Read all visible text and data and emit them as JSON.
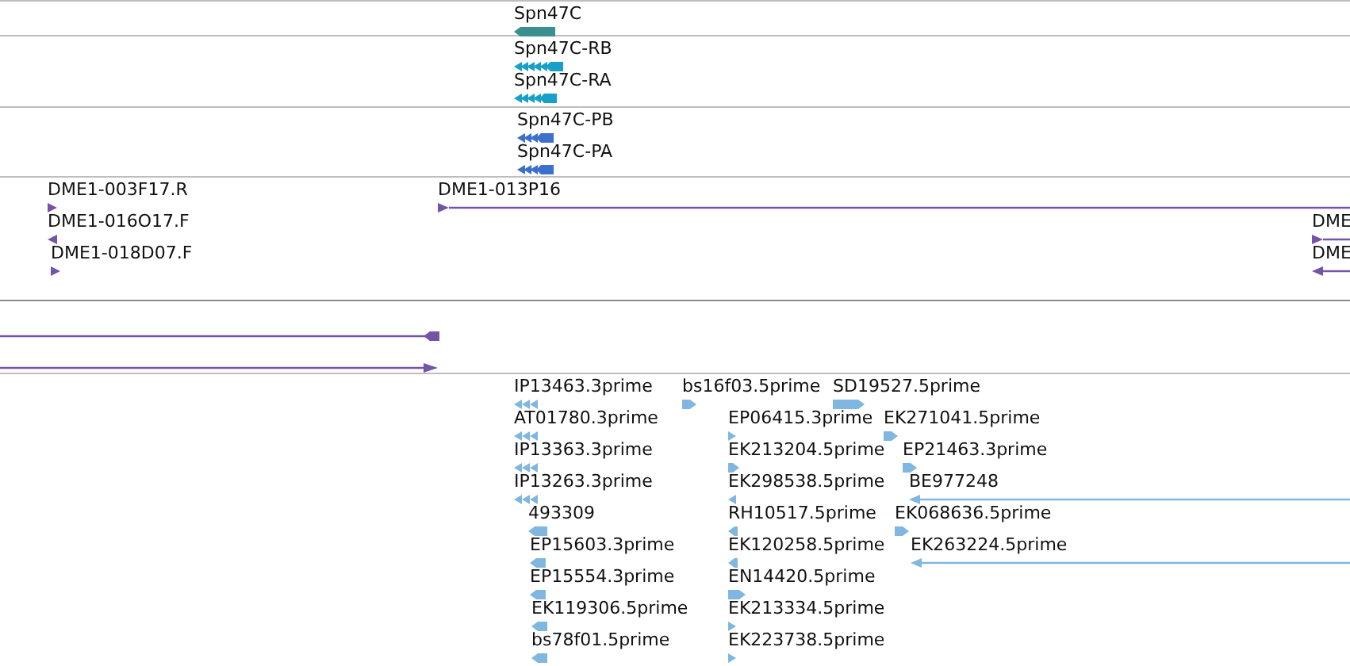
{
  "tracks": [
    {
      "color": "#3a9090",
      "features": [
        {
          "label": "Spn47C",
          "reverse": true
        }
      ]
    },
    {
      "color": "#17a0c8",
      "features": [
        {
          "label": "Spn47C-RB",
          "reverse": true
        },
        {
          "label": "Spn47C-RA",
          "reverse": true
        }
      ]
    },
    {
      "color": "#3d6fcc",
      "features": [
        {
          "label": "Spn47C-PB",
          "reverse": true
        },
        {
          "label": "Spn47C-PA",
          "reverse": true
        }
      ]
    },
    {
      "color": "#7355a8",
      "features": [
        {
          "label": "DME1-003F17.R",
          "reverse": false
        },
        {
          "label": "DME1-013P16",
          "reverse": false
        },
        {
          "label": "DME1-016O17.F",
          "reverse": true
        },
        {
          "label": "DME",
          "reverse": false
        },
        {
          "label": "DME1-018D07.F",
          "reverse": false
        },
        {
          "label": "DME",
          "reverse": true
        }
      ]
    },
    {
      "color": "#7355a8",
      "features": [
        {
          "reverse": true
        },
        {
          "reverse": false
        }
      ]
    },
    {
      "color": "#80b7e0",
      "features": [
        {
          "label": "IP13463.3prime",
          "reverse": true
        },
        {
          "label": "bs16f03.5prime",
          "reverse": false
        },
        {
          "label": "SD19527.5prime",
          "reverse": false
        },
        {
          "label": "AT01780.3prime",
          "reverse": true
        },
        {
          "label": "EP06415.3prime",
          "reverse": false
        },
        {
          "label": "EK271041.5prime",
          "reverse": false
        },
        {
          "label": "IP13363.3prime",
          "reverse": true
        },
        {
          "label": "EK213204.5prime",
          "reverse": false
        },
        {
          "label": "EP21463.3prime",
          "reverse": false
        },
        {
          "label": "IP13263.3prime",
          "reverse": true
        },
        {
          "label": "EK298538.5prime",
          "reverse": true
        },
        {
          "label": "BE977248",
          "reverse": true
        },
        {
          "label": "493309",
          "reverse": true
        },
        {
          "label": "RH10517.5prime",
          "reverse": true
        },
        {
          "label": "EK068636.5prime",
          "reverse": false
        },
        {
          "label": "EP15603.3prime",
          "reverse": true
        },
        {
          "label": "EK120258.5prime",
          "reverse": true
        },
        {
          "label": "EK263224.5prime",
          "reverse": true
        },
        {
          "label": "EP15554.3prime",
          "reverse": true
        },
        {
          "label": "EN14420.5prime",
          "reverse": false
        },
        {
          "label": "EK119306.5prime",
          "reverse": true
        },
        {
          "label": "EK213334.5prime",
          "reverse": false
        },
        {
          "label": "bs78f01.5prime",
          "reverse": true
        },
        {
          "label": "EK223738.5prime",
          "reverse": false
        }
      ]
    }
  ]
}
